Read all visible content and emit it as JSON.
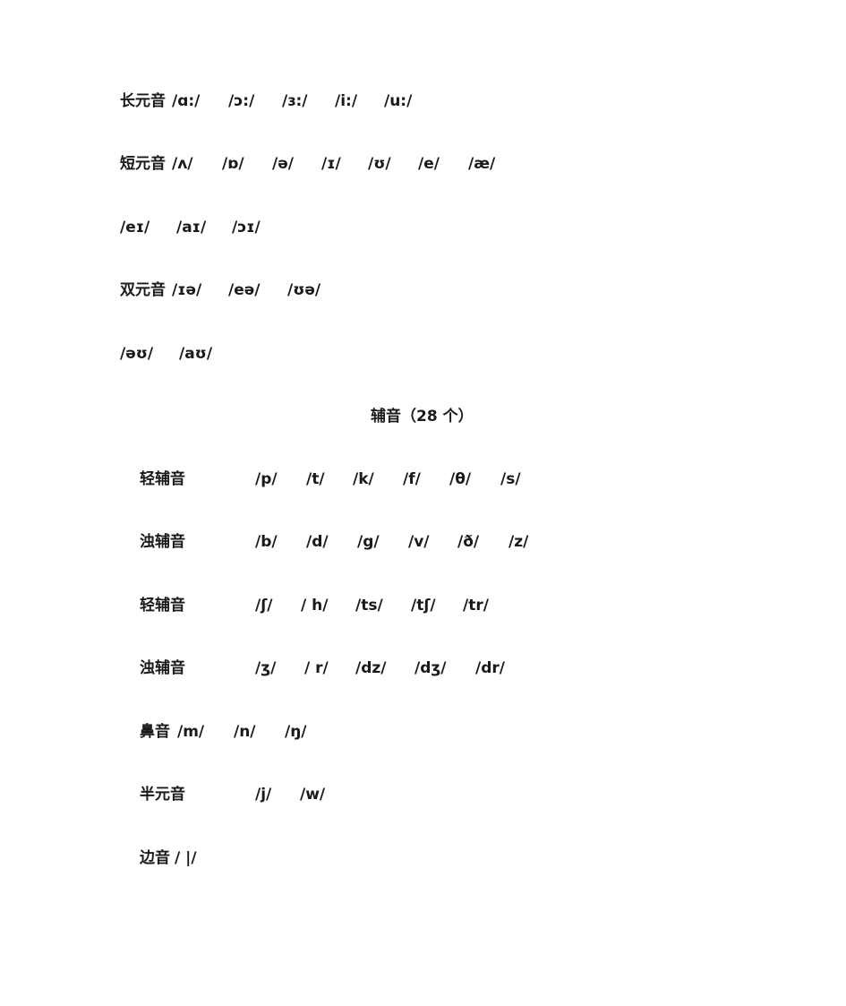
{
  "vowels": {
    "long": {
      "label": "长元音",
      "items": [
        "/ɑ:/",
        "/ɔ:/",
        "/ɜ:/",
        "/i:/",
        "/u:/"
      ]
    },
    "short": {
      "label": "短元音",
      "items": [
        "/ʌ/",
        "/ɒ/",
        "/ə/",
        "/ɪ/",
        "/ʊ/",
        "/e/",
        "/æ/"
      ]
    },
    "diphthong_row1": {
      "items": [
        "/eɪ/",
        "/aɪ/",
        "/ɔɪ/"
      ]
    },
    "diphthong_row2": {
      "label": "双元音",
      "items": [
        "/ɪə/",
        "/eə/",
        "/ʊə/"
      ]
    },
    "diphthong_row3": {
      "items": [
        "/əʊ/",
        "/aʊ/"
      ]
    }
  },
  "consonants_heading": "辅音（28 个）",
  "consonants": {
    "voiceless1": {
      "label": "轻辅音",
      "items": [
        "/p/",
        "/t/",
        "/k/",
        "/f/",
        "/θ/",
        "/s/"
      ]
    },
    "voiced1": {
      "label": "浊辅音",
      "items": [
        "/b/",
        "/d/",
        "/g/",
        "/v/",
        "/ð/",
        "/z/"
      ]
    },
    "voiceless2": {
      "label": "轻辅音",
      "items": [
        "/ʃ/",
        "/ h/",
        "/ts/",
        "/tʃ/",
        "/tr/"
      ]
    },
    "voiced2": {
      "label": "浊辅音",
      "items": [
        "/ʒ/",
        "/ r/",
        "/dz/",
        "/dʒ/",
        "/dr/"
      ]
    },
    "nasal": {
      "label": "鼻音",
      "items": [
        "/m/",
        "/n/",
        "/ŋ/"
      ]
    },
    "semivowel": {
      "label": "半元音",
      "items": [
        "/j/",
        "/w/"
      ]
    },
    "lateral": {
      "label": "边音",
      "items": [
        "/ |/"
      ]
    }
  }
}
